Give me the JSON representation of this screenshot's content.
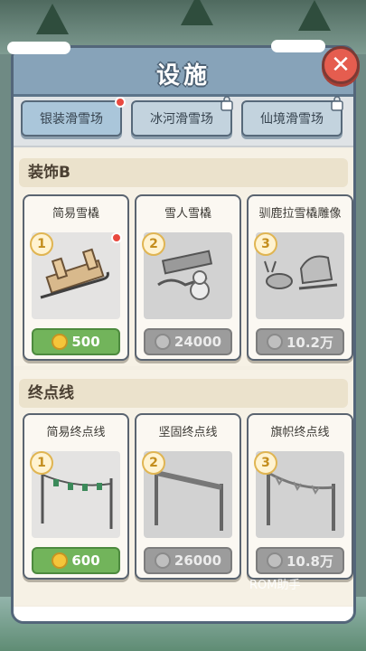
{
  "header": {
    "title": "设施"
  },
  "tabs": [
    {
      "label": "银装滑雪场",
      "active": true,
      "badge": "red-dot"
    },
    {
      "label": "冰河滑雪场",
      "active": false,
      "locked": true
    },
    {
      "label": "仙境滑雪场",
      "active": false,
      "locked": true
    }
  ],
  "sections": [
    {
      "label": "装饰B",
      "items": [
        {
          "name": "简易雪橇",
          "level": "1",
          "price": "500",
          "price_style": "green",
          "badge": "red-dot",
          "icon": "wooden-sled-icon"
        },
        {
          "name": "雪人雪橇",
          "level": "2",
          "price": "24000",
          "price_style": "gray",
          "icon": "snowman-sled-icon"
        },
        {
          "name": "驯鹿拉雪橇雕像",
          "level": "3",
          "price": "10.2万",
          "price_style": "gray",
          "icon": "reindeer-sleigh-icon"
        }
      ]
    },
    {
      "label": "终点线",
      "items": [
        {
          "name": "简易终点线",
          "level": "1",
          "price": "600",
          "price_style": "green",
          "icon": "flag-line-icon"
        },
        {
          "name": "坚固终点线",
          "level": "2",
          "price": "26000",
          "price_style": "gray",
          "icon": "sturdy-finish-line-icon"
        },
        {
          "name": "旗帜终点线",
          "level": "3",
          "price": "10.8万",
          "price_style": "gray",
          "icon": "banner-finish-line-icon"
        }
      ]
    }
  ],
  "watermark": "ROM助手",
  "colors": {
    "accent_green": "#72b45b",
    "header_blue": "#87a3b9",
    "close_red": "#e55d4f"
  }
}
